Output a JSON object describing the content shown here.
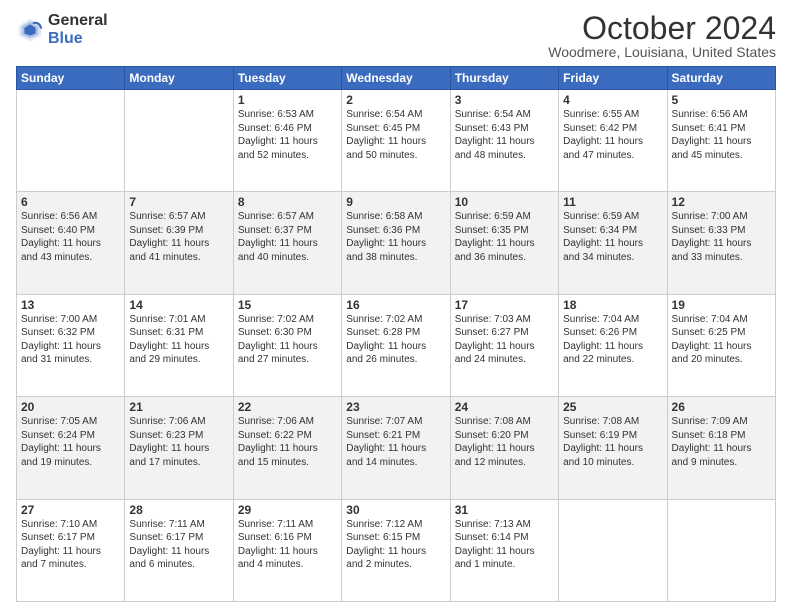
{
  "logo": {
    "line1": "General",
    "line2": "Blue"
  },
  "title": "October 2024",
  "subtitle": "Woodmere, Louisiana, United States",
  "days_of_week": [
    "Sunday",
    "Monday",
    "Tuesday",
    "Wednesday",
    "Thursday",
    "Friday",
    "Saturday"
  ],
  "weeks": [
    [
      {
        "day": "",
        "info": ""
      },
      {
        "day": "",
        "info": ""
      },
      {
        "day": "1",
        "info": "Sunrise: 6:53 AM\nSunset: 6:46 PM\nDaylight: 11 hours\nand 52 minutes."
      },
      {
        "day": "2",
        "info": "Sunrise: 6:54 AM\nSunset: 6:45 PM\nDaylight: 11 hours\nand 50 minutes."
      },
      {
        "day": "3",
        "info": "Sunrise: 6:54 AM\nSunset: 6:43 PM\nDaylight: 11 hours\nand 48 minutes."
      },
      {
        "day": "4",
        "info": "Sunrise: 6:55 AM\nSunset: 6:42 PM\nDaylight: 11 hours\nand 47 minutes."
      },
      {
        "day": "5",
        "info": "Sunrise: 6:56 AM\nSunset: 6:41 PM\nDaylight: 11 hours\nand 45 minutes."
      }
    ],
    [
      {
        "day": "6",
        "info": "Sunrise: 6:56 AM\nSunset: 6:40 PM\nDaylight: 11 hours\nand 43 minutes."
      },
      {
        "day": "7",
        "info": "Sunrise: 6:57 AM\nSunset: 6:39 PM\nDaylight: 11 hours\nand 41 minutes."
      },
      {
        "day": "8",
        "info": "Sunrise: 6:57 AM\nSunset: 6:37 PM\nDaylight: 11 hours\nand 40 minutes."
      },
      {
        "day": "9",
        "info": "Sunrise: 6:58 AM\nSunset: 6:36 PM\nDaylight: 11 hours\nand 38 minutes."
      },
      {
        "day": "10",
        "info": "Sunrise: 6:59 AM\nSunset: 6:35 PM\nDaylight: 11 hours\nand 36 minutes."
      },
      {
        "day": "11",
        "info": "Sunrise: 6:59 AM\nSunset: 6:34 PM\nDaylight: 11 hours\nand 34 minutes."
      },
      {
        "day": "12",
        "info": "Sunrise: 7:00 AM\nSunset: 6:33 PM\nDaylight: 11 hours\nand 33 minutes."
      }
    ],
    [
      {
        "day": "13",
        "info": "Sunrise: 7:00 AM\nSunset: 6:32 PM\nDaylight: 11 hours\nand 31 minutes."
      },
      {
        "day": "14",
        "info": "Sunrise: 7:01 AM\nSunset: 6:31 PM\nDaylight: 11 hours\nand 29 minutes."
      },
      {
        "day": "15",
        "info": "Sunrise: 7:02 AM\nSunset: 6:30 PM\nDaylight: 11 hours\nand 27 minutes."
      },
      {
        "day": "16",
        "info": "Sunrise: 7:02 AM\nSunset: 6:28 PM\nDaylight: 11 hours\nand 26 minutes."
      },
      {
        "day": "17",
        "info": "Sunrise: 7:03 AM\nSunset: 6:27 PM\nDaylight: 11 hours\nand 24 minutes."
      },
      {
        "day": "18",
        "info": "Sunrise: 7:04 AM\nSunset: 6:26 PM\nDaylight: 11 hours\nand 22 minutes."
      },
      {
        "day": "19",
        "info": "Sunrise: 7:04 AM\nSunset: 6:25 PM\nDaylight: 11 hours\nand 20 minutes."
      }
    ],
    [
      {
        "day": "20",
        "info": "Sunrise: 7:05 AM\nSunset: 6:24 PM\nDaylight: 11 hours\nand 19 minutes."
      },
      {
        "day": "21",
        "info": "Sunrise: 7:06 AM\nSunset: 6:23 PM\nDaylight: 11 hours\nand 17 minutes."
      },
      {
        "day": "22",
        "info": "Sunrise: 7:06 AM\nSunset: 6:22 PM\nDaylight: 11 hours\nand 15 minutes."
      },
      {
        "day": "23",
        "info": "Sunrise: 7:07 AM\nSunset: 6:21 PM\nDaylight: 11 hours\nand 14 minutes."
      },
      {
        "day": "24",
        "info": "Sunrise: 7:08 AM\nSunset: 6:20 PM\nDaylight: 11 hours\nand 12 minutes."
      },
      {
        "day": "25",
        "info": "Sunrise: 7:08 AM\nSunset: 6:19 PM\nDaylight: 11 hours\nand 10 minutes."
      },
      {
        "day": "26",
        "info": "Sunrise: 7:09 AM\nSunset: 6:18 PM\nDaylight: 11 hours\nand 9 minutes."
      }
    ],
    [
      {
        "day": "27",
        "info": "Sunrise: 7:10 AM\nSunset: 6:17 PM\nDaylight: 11 hours\nand 7 minutes."
      },
      {
        "day": "28",
        "info": "Sunrise: 7:11 AM\nSunset: 6:17 PM\nDaylight: 11 hours\nand 6 minutes."
      },
      {
        "day": "29",
        "info": "Sunrise: 7:11 AM\nSunset: 6:16 PM\nDaylight: 11 hours\nand 4 minutes."
      },
      {
        "day": "30",
        "info": "Sunrise: 7:12 AM\nSunset: 6:15 PM\nDaylight: 11 hours\nand 2 minutes."
      },
      {
        "day": "31",
        "info": "Sunrise: 7:13 AM\nSunset: 6:14 PM\nDaylight: 11 hours\nand 1 minute."
      },
      {
        "day": "",
        "info": ""
      },
      {
        "day": "",
        "info": ""
      }
    ]
  ]
}
